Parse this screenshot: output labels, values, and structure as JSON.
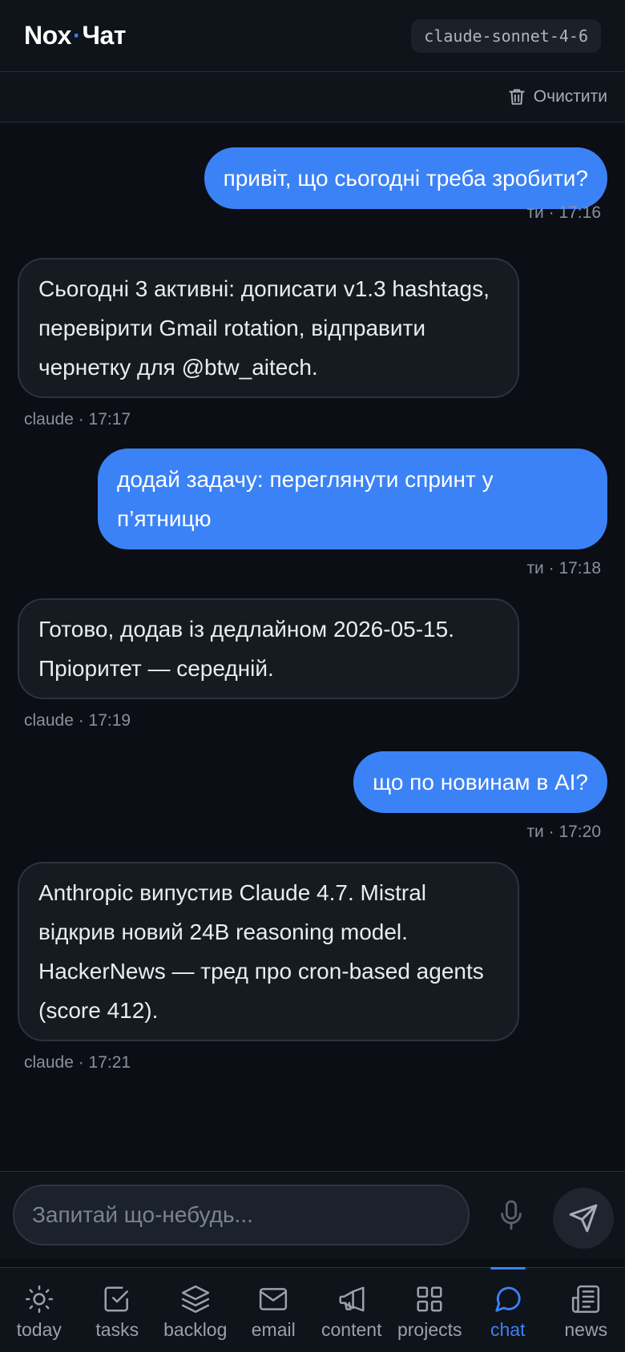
{
  "header": {
    "brand_left": "Nox",
    "brand_dot": "·",
    "brand_right": "Чат",
    "model": "claude-sonnet-4-6"
  },
  "toolbar": {
    "clear_label": "Очистити"
  },
  "messages": [
    {
      "role": "user",
      "text": "привіт, що сьогодні треба зробити?",
      "meta": "ти · 17:16"
    },
    {
      "role": "assistant",
      "text": "Сьогодні 3 активні: дописати v1.3 hashtags, перевірити Gmail rotation, відправити чернетку для @btw_aitech.",
      "meta": "claude · 17:17"
    },
    {
      "role": "user",
      "text": "додай задачу: переглянути спринт у п’ятницю",
      "meta": "ти · 17:18"
    },
    {
      "role": "assistant",
      "text": "Готово, додав із дедлайном 2026-05-15. Пріоритет — середній.",
      "meta": "claude · 17:19"
    },
    {
      "role": "user",
      "text": "що по новинам в AI?",
      "meta": "ти · 17:20"
    },
    {
      "role": "assistant",
      "text": "Anthropic випустив Claude 4.7. Mistral відкрив новий 24B reasoning model. HackerNews — тред про cron-based agents (score 412).",
      "meta": "claude · 17:21"
    }
  ],
  "input": {
    "placeholder": "Запитай що-небудь...",
    "value": ""
  },
  "nav": {
    "active": "chat",
    "items": [
      {
        "id": "today",
        "label": "today",
        "icon": "sun-icon"
      },
      {
        "id": "tasks",
        "label": "tasks",
        "icon": "checkbox-icon"
      },
      {
        "id": "backlog",
        "label": "backlog",
        "icon": "layers-icon"
      },
      {
        "id": "email",
        "label": "email",
        "icon": "mail-icon"
      },
      {
        "id": "content",
        "label": "content",
        "icon": "megaphone-icon"
      },
      {
        "id": "projects",
        "label": "projects",
        "icon": "grid-icon"
      },
      {
        "id": "chat",
        "label": "chat",
        "icon": "chat-bubble-icon"
      },
      {
        "id": "news",
        "label": "news",
        "icon": "newspaper-icon"
      }
    ]
  },
  "colors": {
    "accent": "#3b82f6",
    "background": "#0b0e14",
    "bubble_assistant": "#161b22"
  }
}
